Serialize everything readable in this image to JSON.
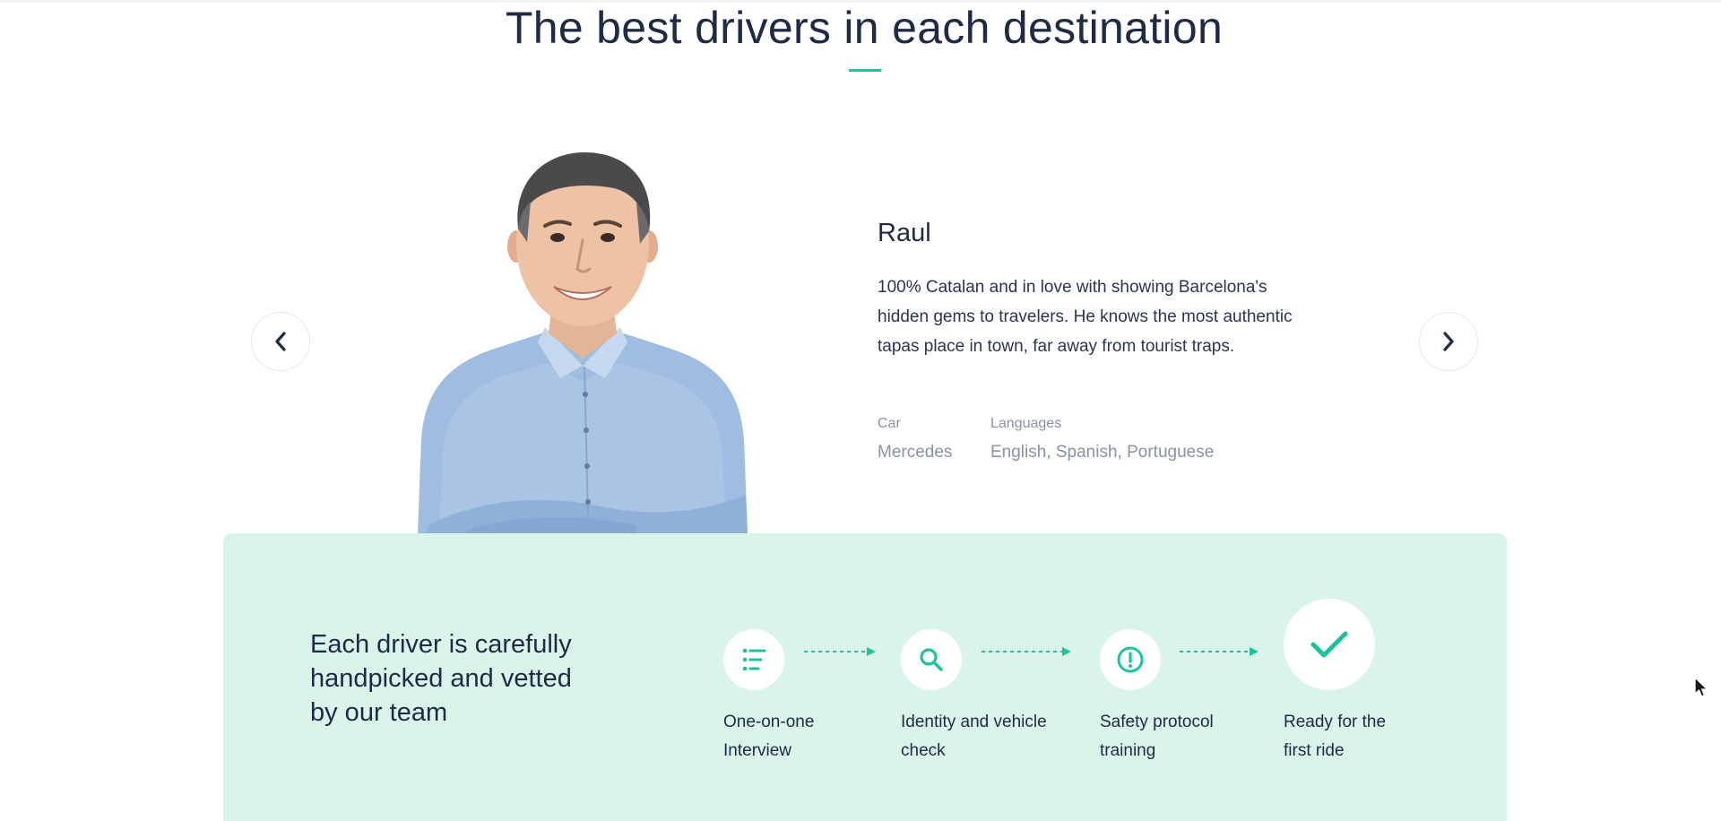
{
  "section": {
    "title": "The best drivers in each destination"
  },
  "carousel": {
    "prev_icon": "chevron-left-icon",
    "next_icon": "chevron-right-icon"
  },
  "driver": {
    "name": "Raul",
    "bio": "100% Catalan and in love with showing Barcelona's hidden gems to travelers. He knows the most authentic tapas place in town, far away from tourist traps.",
    "car_label": "Car",
    "car_value": "Mercedes",
    "languages_label": "Languages",
    "languages_value": "English, Spanish, Portuguese"
  },
  "vetting": {
    "heading": "Each driver is carefully handpicked and vetted by our team",
    "steps": [
      {
        "icon": "list-icon",
        "label_line1": "One-on-one",
        "label_line2": "Interview"
      },
      {
        "icon": "search-icon",
        "label_line1": "Identity and vehicle",
        "label_line2": "check"
      },
      {
        "icon": "alert-icon",
        "label_line1": "Safety protocol",
        "label_line2": "training"
      },
      {
        "icon": "check-icon",
        "label_line1": "Ready for the",
        "label_line2": "first ride"
      }
    ]
  },
  "colors": {
    "accent": "#1cc49b",
    "heading": "#1f2a44",
    "muted": "#8a93a2",
    "vetting_bg": "#d9f5ea"
  }
}
